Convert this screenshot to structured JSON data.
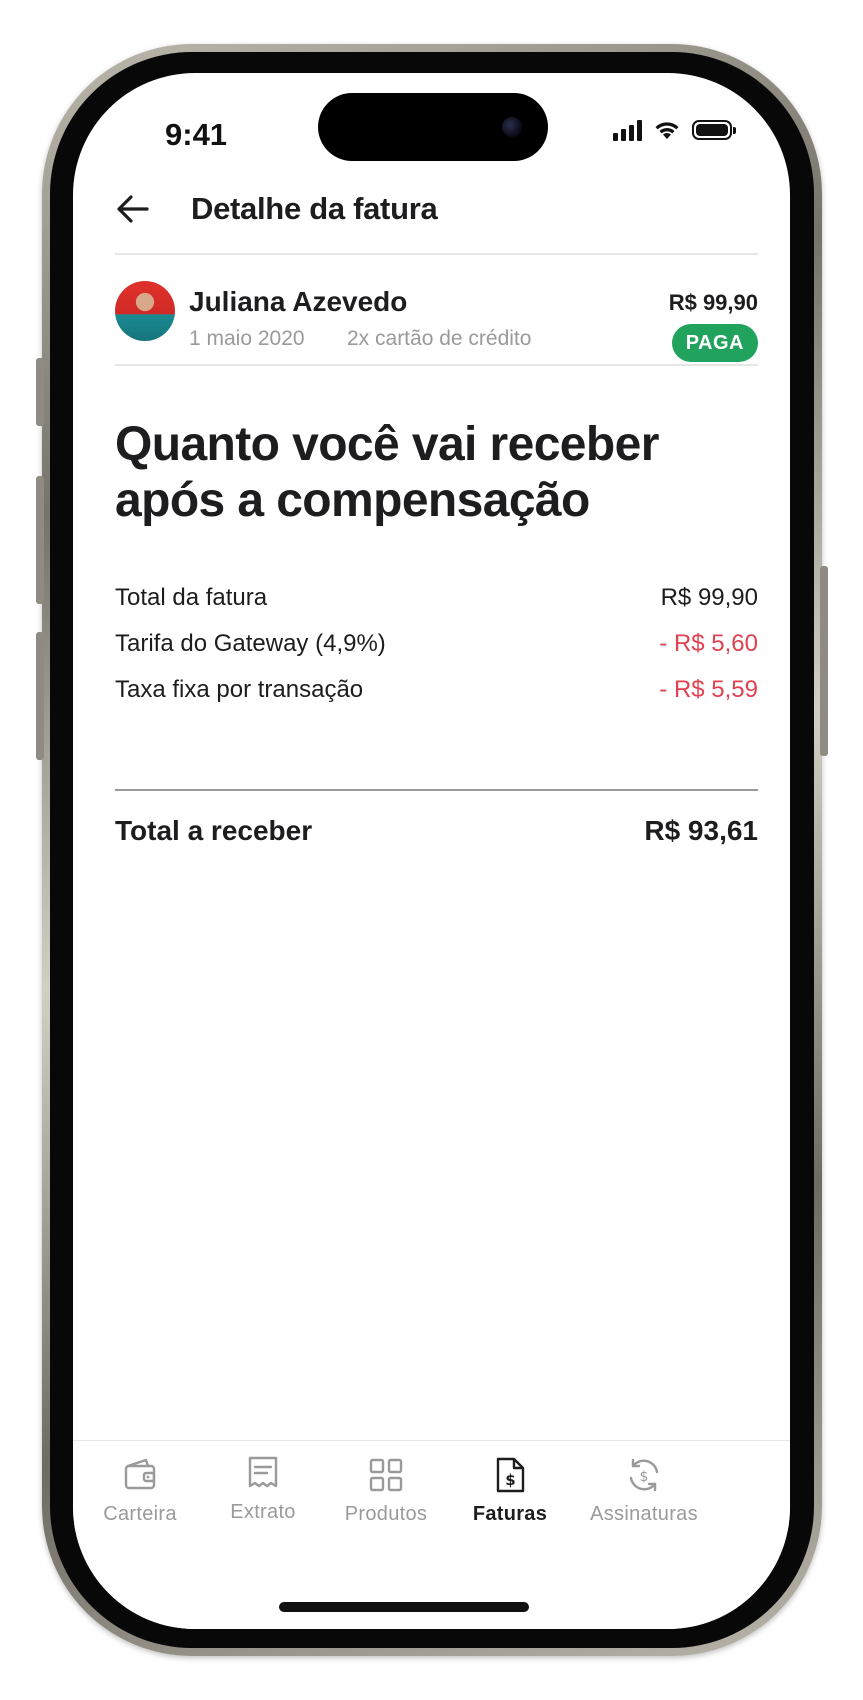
{
  "status_bar": {
    "time": "9:41"
  },
  "header": {
    "title": "Detalhe da fatura",
    "back_icon": "arrow-left-icon"
  },
  "invoice": {
    "customer_name": "Juliana Azevedo",
    "date": "1 maio 2020",
    "payment_method": "2x cartão de crédito",
    "amount": "R$ 99,90",
    "status": "PAGA",
    "status_color": "#21a35e"
  },
  "summary": {
    "heading": "Quanto você vai receber após a compensação",
    "items": [
      {
        "label": "Total da fatura",
        "value": "R$ 99,90"
      },
      {
        "label": "Tarifa do Gateway (4,9%)",
        "value": "- R$ 5,60"
      },
      {
        "label": "Taxa fixa por transação",
        "value": "- R$ 5,59"
      }
    ],
    "negative_color": "#e04150",
    "total_label": "Total a receber",
    "total_value": "R$ 93,61"
  },
  "tabbar": {
    "tabs": [
      {
        "label": "Carteira",
        "icon": "wallet-icon"
      },
      {
        "label": "Extrato",
        "icon": "receipt-icon"
      },
      {
        "label": "Produtos",
        "icon": "grid-icon"
      },
      {
        "label": "Faturas",
        "icon": "invoice-dollar-icon",
        "active": true
      },
      {
        "label": "Assinaturas",
        "icon": "recurring-dollar-icon"
      }
    ]
  }
}
